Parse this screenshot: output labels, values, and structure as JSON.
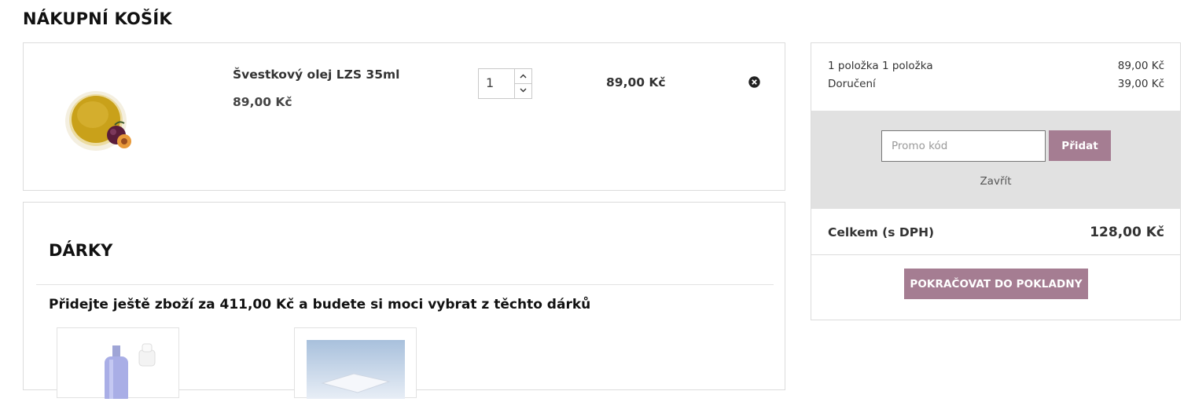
{
  "page": {
    "title": "NÁKUPNÍ KOŠÍK"
  },
  "cart": {
    "item": {
      "name": "Švestkový olej LZS 35ml",
      "unit_price": "89,00 Kč",
      "quantity": "1",
      "line_total": "89,00 Kč",
      "remove_icon": "close-circle-icon"
    }
  },
  "gifts": {
    "title": "DÁRKY",
    "message": "Přidejte ještě zboží za 411,00 Kč a budete si moci vybrat z těchto dárků"
  },
  "summary": {
    "rows": [
      {
        "label": "1 položka 1 položka",
        "value": "89,00 Kč"
      },
      {
        "label": "Doručení",
        "value": "39,00 Kč"
      }
    ],
    "promo": {
      "placeholder": "Promo kód",
      "value": "",
      "apply_label": "Přidat",
      "close_label": "Zavřít"
    },
    "total_label": "Celkem (s DPH)",
    "total_value": "128,00 Kč",
    "checkout_label": "POKRAČOVAT DO POKLADNY"
  },
  "colors": {
    "accent": "#a57d92",
    "promo_bg": "#e1e1e1",
    "border": "#dcdcdc"
  }
}
